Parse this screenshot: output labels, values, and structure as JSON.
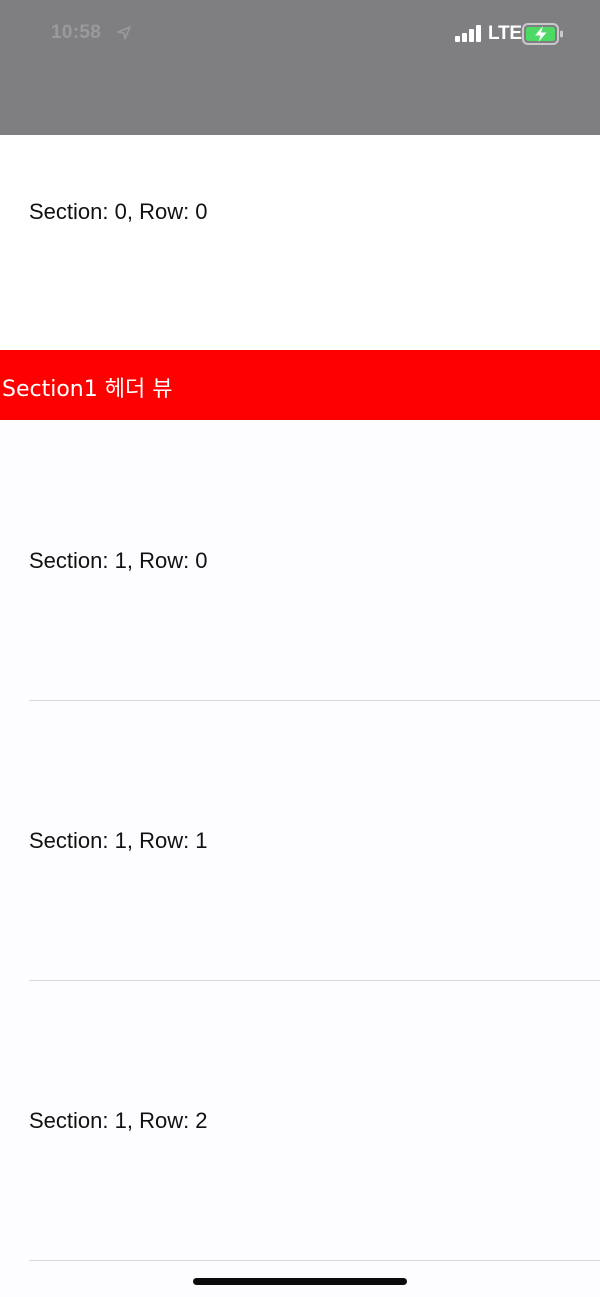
{
  "status_bar": {
    "time": "10:58",
    "network": "LTE",
    "background_color": "#7f7e80",
    "battery_fill_color": "#4cd964",
    "icons": [
      "location-arrow-icon",
      "cellular-signal-icon",
      "battery-charging-icon"
    ]
  },
  "table": {
    "sections": [
      {
        "header": "",
        "rows": [
          "Section: 0, Row: 0"
        ]
      },
      {
        "header": "Section1 헤더 뷰",
        "header_color": "#ff0000",
        "rows": [
          "Section: 1, Row: 0",
          "Section: 1, Row: 1",
          "Section: 1, Row: 2"
        ]
      }
    ]
  }
}
